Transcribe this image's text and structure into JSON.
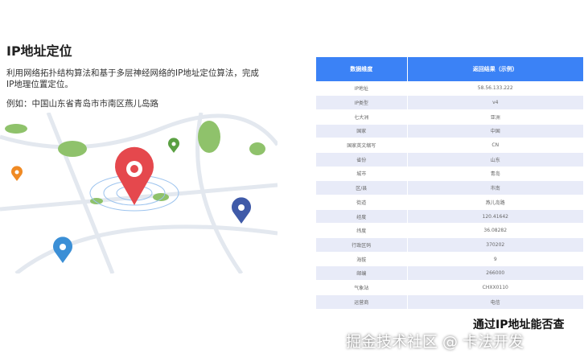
{
  "title": "IP地址定位",
  "description": "利用网络拓扑结构算法和基于多层神经网络的IP地址定位算法，完成IP地理位置定位。",
  "example": "例如：中国山东省青岛市市南区燕儿岛路",
  "table": {
    "headers": [
      "数据维度",
      "返回结果（示例）"
    ],
    "rows": [
      [
        "IP地址",
        "58.56.133.222"
      ],
      [
        "IP类型",
        "v4"
      ],
      [
        "七大洲",
        "亚洲"
      ],
      [
        "国家",
        "中国"
      ],
      [
        "国家英文缩写",
        "CN"
      ],
      [
        "省份",
        "山东"
      ],
      [
        "城市",
        "青岛"
      ],
      [
        "区/县",
        "市南"
      ],
      [
        "街道",
        "燕儿岛路"
      ],
      [
        "经度",
        "120.41642"
      ],
      [
        "纬度",
        "36.08282"
      ],
      [
        "行政区码",
        "370202"
      ],
      [
        "海拔",
        "9"
      ],
      [
        "邮编",
        "266000"
      ],
      [
        "气象站",
        "CHXX0110"
      ],
      [
        "运营商",
        "电信"
      ]
    ]
  },
  "watermark": {
    "overlay": "通过IP地址能否查",
    "footer": "掘金技术社区 @ 卡法开发"
  },
  "colors": {
    "header": "#3b82f6",
    "pin_main": "#e5484d"
  }
}
